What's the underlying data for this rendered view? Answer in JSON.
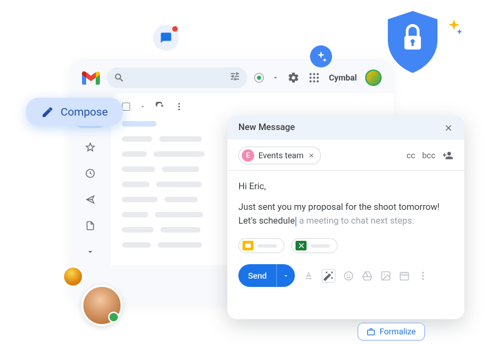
{
  "compose_button": {
    "label": "Compose"
  },
  "header": {
    "brand": "Cymbal"
  },
  "compose": {
    "title": "New Message",
    "recipient": {
      "initial": "E",
      "name": "Events team"
    },
    "cc": "cc",
    "bcc": "bcc",
    "body": {
      "greeting": "Hi Eric,",
      "line1": "Just sent you my proposal for the shoot tomorrow!",
      "typed": "Let's schedule",
      "suggestion": " a meeting to chat next steps."
    },
    "send_label": "Send"
  },
  "formalize": {
    "label": "Formalize"
  }
}
